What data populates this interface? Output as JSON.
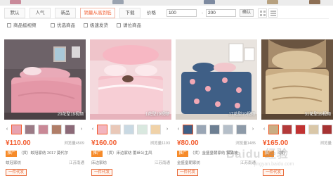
{
  "sort_bar": {
    "tabs": [
      {
        "label": "默认",
        "active": false
      },
      {
        "label": "人气",
        "active": false
      },
      {
        "label": "新品",
        "active": false
      },
      {
        "label": "销量从高到低",
        "active": true
      },
      {
        "label": "下载",
        "active": false
      }
    ],
    "price_label": "价格",
    "price_min": "100",
    "price_max": "200",
    "price_dash": "-",
    "confirm_label": "确认"
  },
  "filters": [
    {
      "label": "商品挺视频",
      "checked": false
    },
    {
      "label": "优选商品",
      "checked": false
    },
    {
      "label": "极速发货",
      "checked": false
    },
    {
      "label": "请位商品",
      "checked": false
    }
  ],
  "products": [
    {
      "pic_count": "20花型19视频",
      "price": "¥110.00",
      "sold": "浏览量4509",
      "promo_badge": "推广",
      "title": "（货）蚊冠家纺 2017 莫代尔",
      "shop": "蚊冠家纺",
      "location": "江苏南通",
      "dropship_badge": "一件代发",
      "colors": [
        "#e8a3b0",
        "#6f5a5f",
        "#d9b8be"
      ]
    },
    {
      "pic_count": "1花型19视频",
      "price": "¥160.00",
      "sold": "浏览量1193",
      "promo_badge": "推广",
      "title": "（货）床边家纺 蕾丝公主风",
      "shop": "床边家纺",
      "location": "江苏南通",
      "dropship_badge": "一件代发",
      "colors": [
        "#f3b5bf",
        "#fbe3e6",
        "#ffffff"
      ]
    },
    {
      "pic_count": "17花型19视频",
      "price": "¥80.00",
      "sold": "浏览量1485",
      "promo_badge": "推广",
      "title": "（货）金盛皇朝家纺 猫猫被",
      "shop": "金盛皇朝家纺",
      "location": "江苏南通",
      "dropship_badge": "一件代发",
      "colors": [
        "#3f5f86",
        "#f2c7cc",
        "#e9e3de"
      ]
    },
    {
      "pic_count": "31花型19视频",
      "price": "¥165.00",
      "sold": "浏览量",
      "promo_badge": "推广",
      "title": "（货）",
      "shop": "",
      "location": "",
      "dropship_badge": "一件代发",
      "colors": [
        "#b89e7a",
        "#e7d6b5",
        "#8a7459"
      ]
    }
  ],
  "watermark": {
    "text": "Baidu 经验",
    "sub": "jingyan.baidu.com"
  },
  "accent_color": "#f25c2e"
}
